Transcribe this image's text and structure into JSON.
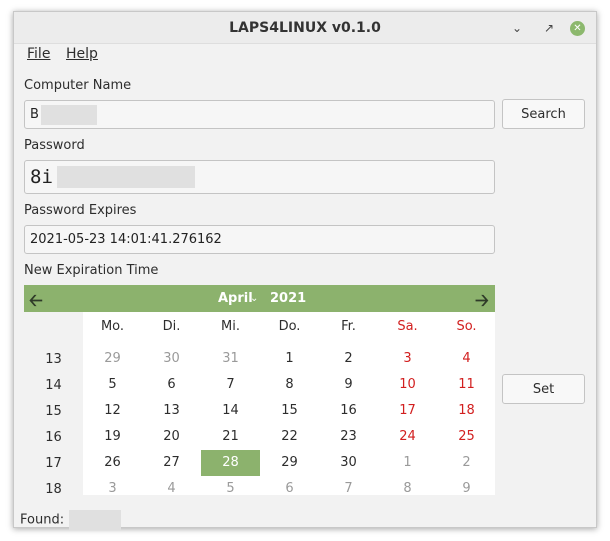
{
  "window": {
    "title": "LAPS4LINUX v0.1.0"
  },
  "menu": {
    "file": "File",
    "help": "Help"
  },
  "computer_name": {
    "label": "Computer Name",
    "value": "B"
  },
  "password": {
    "label": "Password",
    "value": "8i"
  },
  "password_expires": {
    "label": "Password Expires",
    "value": "2021-05-23 14:01:41.276162"
  },
  "new_expiration": {
    "label": "New Expiration Time"
  },
  "buttons": {
    "search": "Search",
    "set": "Set"
  },
  "calendar": {
    "month": "April",
    "year": "2021",
    "weekdays": [
      "Mo.",
      "Di.",
      "Mi.",
      "Do.",
      "Fr.",
      "Sa.",
      "So."
    ],
    "weeks": [
      "13",
      "14",
      "15",
      "16",
      "17",
      "18"
    ],
    "rows": [
      [
        "29",
        "30",
        "31",
        "1",
        "2",
        "3",
        "4"
      ],
      [
        "5",
        "6",
        "7",
        "8",
        "9",
        "10",
        "11"
      ],
      [
        "12",
        "13",
        "14",
        "15",
        "16",
        "17",
        "18"
      ],
      [
        "19",
        "20",
        "21",
        "22",
        "23",
        "24",
        "25"
      ],
      [
        "26",
        "27",
        "28",
        "29",
        "30",
        "1",
        "2"
      ],
      [
        "3",
        "4",
        "5",
        "6",
        "7",
        "8",
        "9"
      ]
    ],
    "selected": "28"
  },
  "status": {
    "found_label": "Found:"
  },
  "colors": {
    "accent": "#8cb26d",
    "weekend": "#d21f1f",
    "muted": "#9a9a9a"
  }
}
